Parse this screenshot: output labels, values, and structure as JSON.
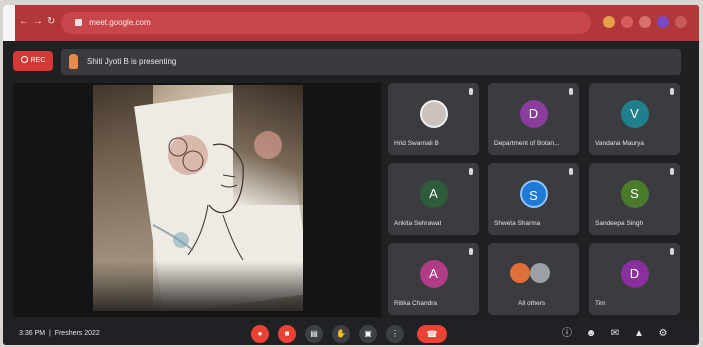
{
  "browser": {
    "url": "meet.google.com",
    "back_icon": "arrow-left",
    "forward_icon": "arrow-right",
    "reload_icon": "refresh"
  },
  "meeting": {
    "rec_label": "REC",
    "presenting_text": "Shiti Jyoti B is presenting",
    "time": "3:36 PM",
    "meeting_name": "Freshers 2022"
  },
  "participants": [
    {
      "name": "Hrid Swarnali B",
      "initial": "",
      "color": "#c9c2bd"
    },
    {
      "name": "Department of Botan...",
      "initial": "D",
      "color": "#8a3d9a"
    },
    {
      "name": "Vandana Maurya",
      "initial": "V",
      "color": "#1f7f8c"
    },
    {
      "name": "Ankita Sehrawat",
      "initial": "A",
      "color": "#2f5c3a"
    },
    {
      "name": "Shweta Sharma",
      "initial": "S",
      "color": "#1e7ad6"
    },
    {
      "name": "Sandeepa Singh",
      "initial": "S",
      "color": "#4a7a2c"
    },
    {
      "name": "Ritika Chandra",
      "initial": "A",
      "color": "#b23b86"
    },
    {
      "name": "All others",
      "initial": "",
      "color": "#e0703a"
    },
    {
      "name": "Tim",
      "initial": "D",
      "color": "#8a2f9e"
    }
  ],
  "colors": {
    "browser_bar": "#b2373a",
    "meet_bg": "#1f2022",
    "tile_bg": "#3b3c3f",
    "end_call": "#ea4335"
  }
}
